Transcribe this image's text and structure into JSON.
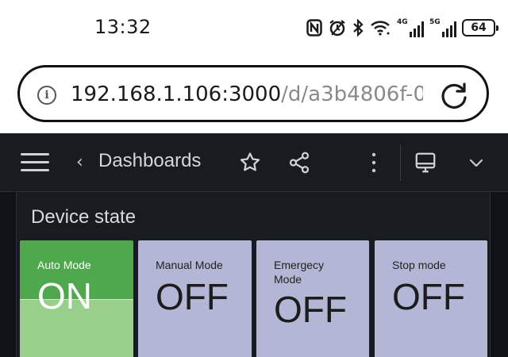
{
  "status_bar": {
    "time": "13:32",
    "icons": [
      "nfc-icon",
      "alarm-icon",
      "bluetooth-icon",
      "wifi-icon",
      "signal-4g-icon",
      "signal-5g-icon"
    ],
    "net1_label": "4G",
    "net2_label": "5G",
    "battery": "64"
  },
  "browser": {
    "url_host": "192.168.1.106:3000",
    "url_path": "/d/a3b4806f-0",
    "info_glyph": "i"
  },
  "header": {
    "back_glyph": "‹",
    "title": "Dashboards"
  },
  "panel": {
    "title": "Device state",
    "tiles": [
      {
        "label": "Auto Mode",
        "value": "ON",
        "color": "#4fa84d"
      },
      {
        "label": "Manual Mode",
        "value": "OFF",
        "color": "#b3b6d5"
      },
      {
        "label": "Emergecy Mode",
        "value": "OFF",
        "color": "#b3b6d5"
      },
      {
        "label": "Stop mode",
        "value": "OFF",
        "color": "#b3b6d5"
      }
    ]
  },
  "colors": {
    "header_bg": "#181b1f",
    "body_bg": "#111217",
    "on_green": "#4fa84d",
    "on_sparkline_fill": "#98cf8a",
    "off_lavender": "#b3b6d5"
  }
}
